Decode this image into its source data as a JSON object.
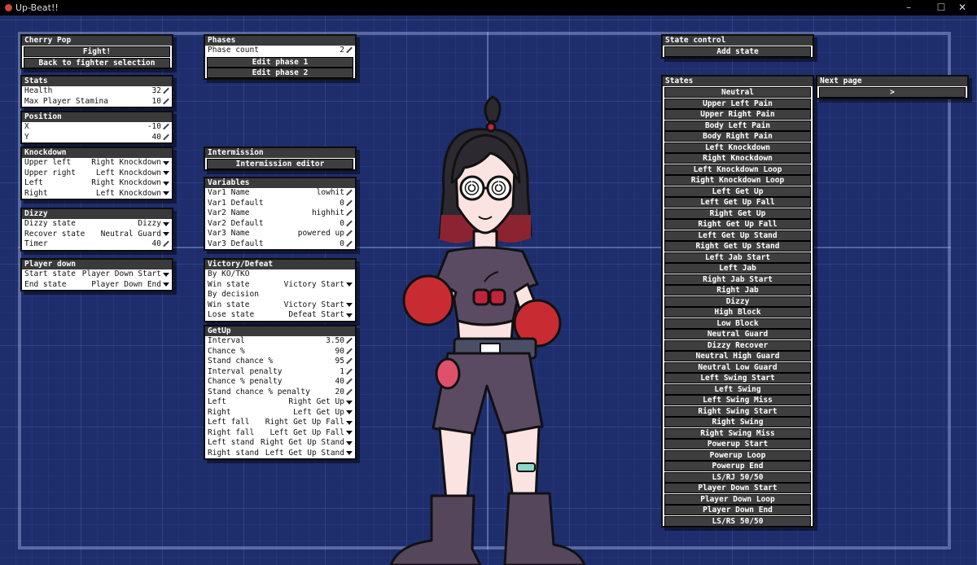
{
  "window": {
    "title": "Up-Beat!!",
    "min_glyph": "–",
    "max_glyph": "☐",
    "close_glyph": "✕"
  },
  "fighter": {
    "name": "Cherry Pop",
    "fight_label": "Fight!",
    "back_label": "Back to fighter selection"
  },
  "stats": {
    "title": "Stats",
    "rows": [
      {
        "label": "Health",
        "value": "32"
      },
      {
        "label": "Max Player Stamina",
        "value": "10"
      }
    ]
  },
  "position": {
    "title": "Position",
    "rows": [
      {
        "label": "X",
        "value": "-10"
      },
      {
        "label": "Y",
        "value": "40"
      }
    ]
  },
  "knockdown": {
    "title": "Knockdown",
    "rows": [
      {
        "label": "Upper left",
        "value": "Right Knockdown"
      },
      {
        "label": "Upper right",
        "value": "Left Knockdown"
      },
      {
        "label": "Left",
        "value": "Right Knockdown"
      },
      {
        "label": "Right",
        "value": "Left Knockdown"
      }
    ]
  },
  "dizzy": {
    "title": "Dizzy",
    "rows": [
      {
        "label": "Dizzy state",
        "value": "Dizzy"
      },
      {
        "label": "Recover state",
        "value": "Neutral Guard"
      },
      {
        "label": "Timer",
        "value": "40"
      }
    ]
  },
  "player_down": {
    "title": "Player down",
    "rows": [
      {
        "label": "Start state",
        "value": "Player Down Start"
      },
      {
        "label": "End state",
        "value": "Player Down End"
      }
    ]
  },
  "phases": {
    "title": "Phases",
    "count_label": "Phase count",
    "count_value": "2",
    "buttons": [
      "Edit phase 1",
      "Edit phase 2"
    ]
  },
  "intermission": {
    "title": "Intermission",
    "button": "Intermission editor"
  },
  "variables": {
    "title": "Variables",
    "rows": [
      {
        "label": "Var1 Name",
        "value": "lowhit"
      },
      {
        "label": "Var1 Default",
        "value": "0"
      },
      {
        "label": "Var2 Name",
        "value": "highhit"
      },
      {
        "label": "Var2 Default",
        "value": "0"
      },
      {
        "label": "Var3 Name",
        "value": "powered up"
      },
      {
        "label": "Var3 Default",
        "value": "0"
      }
    ]
  },
  "victory": {
    "title": "Victory/Defeat",
    "rows": [
      {
        "label": "By KO/TKO",
        "value": ""
      },
      {
        "label": "Win state",
        "value": "Victory Start"
      },
      {
        "label": "By decision",
        "value": ""
      },
      {
        "label": "Win state",
        "value": "Victory Start"
      },
      {
        "label": "Lose state",
        "value": "Defeat Start"
      }
    ]
  },
  "getup": {
    "title": "GetUp",
    "rows": [
      {
        "label": "Interval",
        "value": "3.50"
      },
      {
        "label": "Chance %",
        "value": "90"
      },
      {
        "label": "Stand chance %",
        "value": "95"
      },
      {
        "label": "Interval penalty",
        "value": "1"
      },
      {
        "label": "Chance % penalty",
        "value": "40"
      },
      {
        "label": "Stand chance % penalty",
        "value": "20"
      },
      {
        "label": "Left",
        "value": "Right Get Up"
      },
      {
        "label": "Right",
        "value": "Left Get Up"
      },
      {
        "label": "Left fall",
        "value": "Right Get Up Fall"
      },
      {
        "label": "Right fall",
        "value": "Left Get Up Fall"
      },
      {
        "label": "Left stand",
        "value": "Right Get Up Stand"
      },
      {
        "label": "Right stand",
        "value": "Left Get Up Stand"
      }
    ]
  },
  "state_control": {
    "title": "State control",
    "button": "Add state"
  },
  "states": {
    "title": "States",
    "items": [
      "Neutral",
      "Upper Left Pain",
      "Upper Right Pain",
      "Body Left Pain",
      "Body Right Pain",
      "Left Knockdown",
      "Right Knockdown",
      "Left Knockdown Loop",
      "Right Knockdown Loop",
      "Left Get Up",
      "Left Get Up Fall",
      "Right Get Up",
      "Right Get Up Fall",
      "Left Get Up Stand",
      "Right Get Up Stand",
      "Left Jab Start",
      "Left Jab",
      "Right Jab Start",
      "Right Jab",
      "Dizzy",
      "High Block",
      "Low Block",
      "Neutral Guard",
      "Dizzy Recover",
      "Neutral High Guard",
      "Neutral Low Guard",
      "Left Swing Start",
      "Left Swing",
      "Left Swing Miss",
      "Right Swing Start",
      "Right Swing",
      "Right Swing Miss",
      "Powerup Start",
      "Powerup Loop",
      "Powerup End",
      "LS/RJ 50/50",
      "Player Down Start",
      "Player Down Loop",
      "Player Down End",
      "LS/RS 50/50"
    ]
  },
  "next_page": {
    "title": "Next page",
    "button": ">"
  }
}
